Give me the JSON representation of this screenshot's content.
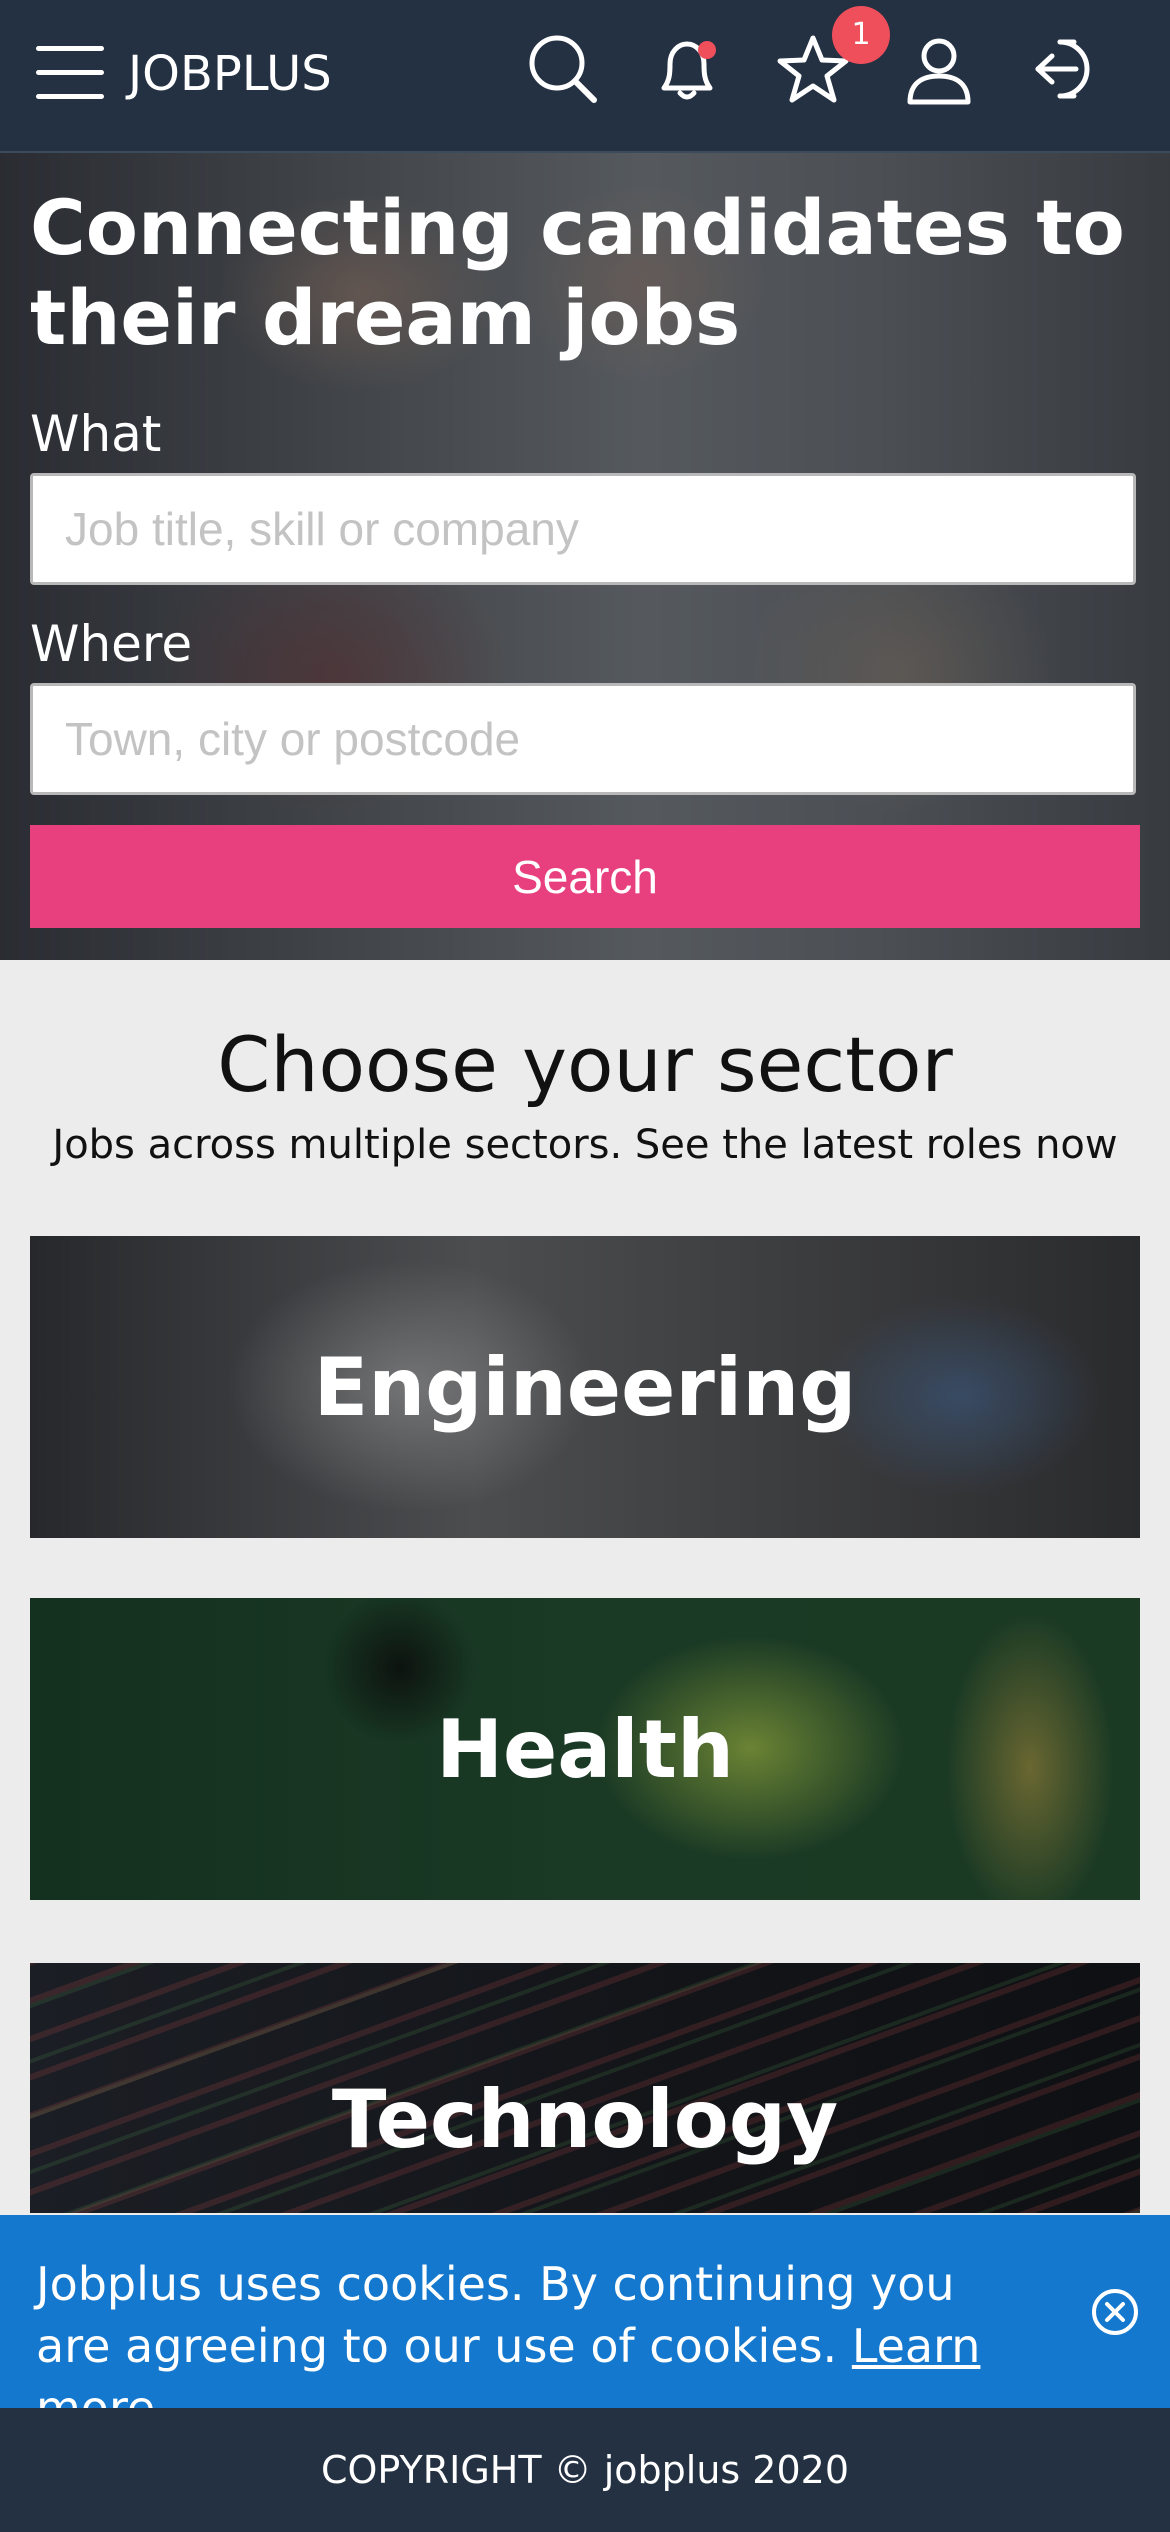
{
  "header": {
    "brand": "JOBPLUS",
    "favorites_badge": "1",
    "icons": [
      "menu-icon",
      "search-icon",
      "bell-icon",
      "star-icon",
      "user-icon",
      "logout-icon"
    ]
  },
  "hero": {
    "title": "Connecting candidates to their dream jobs",
    "what_label": "What",
    "what_placeholder": "Job title, skill or company",
    "where_label": "Where",
    "where_placeholder": "Town, city or postcode",
    "search_button": "Search"
  },
  "sectors": {
    "title": "Choose your sector",
    "subtitle": "Jobs across multiple sectors. See the latest roles now",
    "items": [
      {
        "label": "Engineering"
      },
      {
        "label": "Health"
      },
      {
        "label": "Technology"
      }
    ]
  },
  "cookie": {
    "text": "Jobplus uses cookies. By continuing you are agreeing to our use of cookies.",
    "link": "Learn more",
    "suffix": "."
  },
  "footer": {
    "copyright": "COPYRIGHT © jobplus 2020"
  },
  "colors": {
    "header_bg": "#243143",
    "accent_pink": "#e8407f",
    "cookie_blue": "#1478ce",
    "notification_red": "#ef4f5a"
  }
}
